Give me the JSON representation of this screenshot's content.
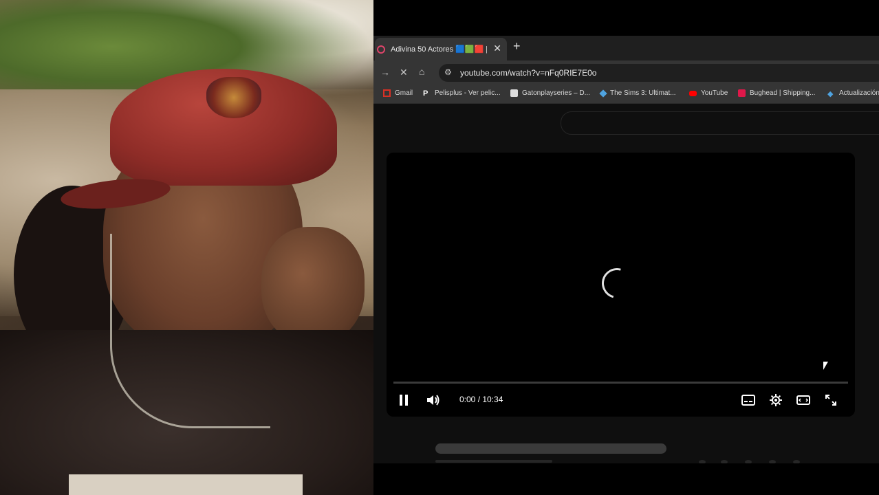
{
  "browser": {
    "tab": {
      "title": "Adivina 50 Actores 🟦🟩🟥 | ...",
      "close": "✕"
    },
    "new_tab": "+",
    "url": "youtube.com/watch?v=nFq0RIE7E0o",
    "bookmarks": [
      {
        "label": "Gmail",
        "icon": "gmail-icon",
        "color": "#d93025"
      },
      {
        "label": "Pelisplus - Ver pelic...",
        "icon": "pelisplus-icon",
        "color": "#ffffff"
      },
      {
        "label": "Gatonplayseries – D...",
        "icon": "gatonplay-icon",
        "color": "#dddddd"
      },
      {
        "label": "The Sims 3: Ultimat...",
        "icon": "sims-icon",
        "color": "#4fa3e0"
      },
      {
        "label": "YouTube",
        "icon": "youtube-icon",
        "color": "#ff0000"
      },
      {
        "label": "Bughead | Shipping...",
        "icon": "bughead-icon",
        "color": "#e0184a"
      },
      {
        "label": "Actualización",
        "icon": "actualizacion-icon",
        "color": "#4fa3e0"
      }
    ]
  },
  "player": {
    "time": "0:00 / 10:34",
    "state": "loading",
    "progress": 0
  },
  "colors": {
    "page_bg": "#0f0f0f",
    "toolbar_bg": "#353535",
    "tab_accent": "#e0446a"
  }
}
